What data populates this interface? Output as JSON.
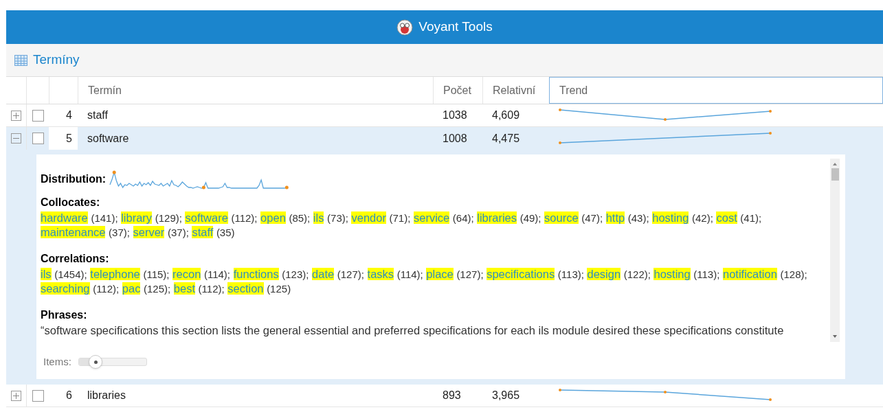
{
  "header": {
    "title": "Voyant Tools"
  },
  "panel": {
    "title": "Termíny"
  },
  "table": {
    "columns": [
      "Termín",
      "Počet",
      "Relativní",
      "Trend"
    ],
    "rows": [
      {
        "rank": "4",
        "term": "staff",
        "count": "1038",
        "relative": "4,609",
        "expanded": false,
        "selected": false,
        "checked": false
      },
      {
        "rank": "5",
        "term": "software",
        "count": "1008",
        "relative": "4,475",
        "expanded": true,
        "selected": true,
        "checked": false,
        "details": {
          "distribution_label": "Distribution:",
          "collocates_label": "Collocates:",
          "collocates": [
            {
              "term": "hardware",
              "count": "(141);"
            },
            {
              "term": "library",
              "count": "(129);"
            },
            {
              "term": "software",
              "count": "(112);"
            },
            {
              "term": "open",
              "count": "(85);"
            },
            {
              "term": "ils",
              "count": "(73);"
            },
            {
              "term": "vendor",
              "count": "(71);"
            },
            {
              "term": "service",
              "count": "(64);"
            },
            {
              "term": "libraries",
              "count": "(49);"
            },
            {
              "term": "source",
              "count": "(47);"
            },
            {
              "term": "http",
              "count": "(43);"
            },
            {
              "term": "hosting",
              "count": "(42);"
            },
            {
              "term": "cost",
              "count": "(41);"
            },
            {
              "term": "maintenance",
              "count": "(37);"
            },
            {
              "term": "server",
              "count": "(37);"
            },
            {
              "term": "staff",
              "count": "(35)"
            }
          ],
          "correlations_label": "Correlations:",
          "correlations": [
            {
              "term": "ils",
              "count": "(1454);"
            },
            {
              "term": "telephone",
              "count": "(115);"
            },
            {
              "term": "recon",
              "count": "(114);"
            },
            {
              "term": "functions",
              "count": "(123);"
            },
            {
              "term": "date",
              "count": "(127);"
            },
            {
              "term": "tasks",
              "count": "(114);"
            },
            {
              "term": "place",
              "count": "(127);"
            },
            {
              "term": "specifications",
              "count": "(113);"
            },
            {
              "term": "design",
              "count": "(122);"
            },
            {
              "term": "hosting",
              "count": "(113);"
            },
            {
              "term": "notification",
              "count": "(128);"
            },
            {
              "term": "searching",
              "count": "(112);"
            },
            {
              "term": "pac",
              "count": "(125);"
            },
            {
              "term": "best",
              "count": "(112);"
            },
            {
              "term": "section",
              "count": "(125)"
            }
          ],
          "phrases_label": "Phrases:",
          "phrases": "“software specifications this section lists the general essential and preferred specifications for each ils module desired these specifications constitute",
          "items_label": "Items:",
          "level": 0.25
        }
      },
      {
        "rank": "6",
        "term": "libraries",
        "count": "893",
        "relative": "3,965",
        "expanded": false,
        "selected": false,
        "checked": false
      }
    ]
  }
}
